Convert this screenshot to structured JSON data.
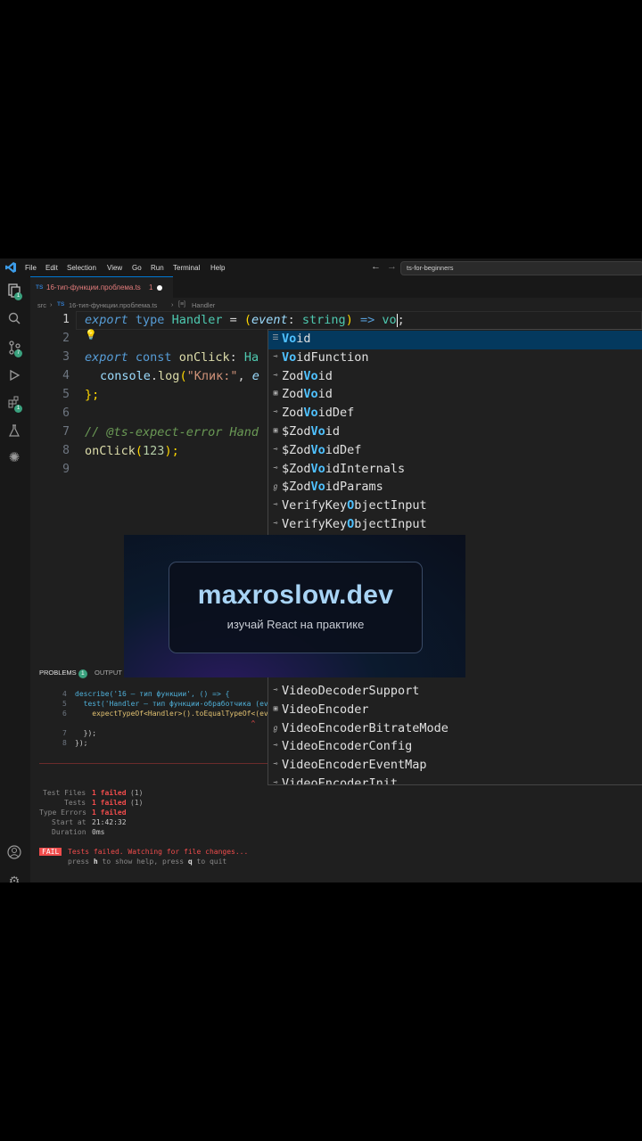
{
  "titlebar": {
    "menu": [
      "File",
      "Edit",
      "Selection",
      "View",
      "Go",
      "Run",
      "Terminal",
      "Help"
    ],
    "search": "ts-for-beginners"
  },
  "tab": {
    "badge": "TS",
    "name": "16-тип-функции.проблема.ts",
    "count": "1"
  },
  "breadcrumb": {
    "folder": "src",
    "badge": "TS",
    "file": "16-тип-функции.проблема.ts",
    "symbol": "Handler"
  },
  "activity_badges": [
    "1",
    "7",
    "1"
  ],
  "editor": {
    "line_numbers": [
      "1",
      "2",
      "3",
      "4",
      "5",
      "6",
      "7",
      "8",
      "9"
    ],
    "line1": {
      "export": "export",
      "type": "type",
      "name": "Handler",
      "eq": " = ",
      "open": "(",
      "param": "event",
      "colon": ": ",
      "ptype": "string",
      "close": ")",
      "arrow": " => ",
      "typed": "vo",
      "semi": ";"
    },
    "line3": {
      "export": "export",
      "const": "const",
      "name": "onClick",
      "colon": ":",
      "partial": "Ha"
    },
    "line4": {
      "obj": "console",
      "dot": ".",
      "method": "log",
      "open": "(",
      "str": "\"Клик:\"",
      "comma": ", ",
      "partial": "e"
    },
    "line5": {
      "text": "};"
    },
    "line7": {
      "comment": "// @ts-expect-error Hand"
    },
    "line8": {
      "fn": "onClick",
      "open": "(",
      "num": "123",
      "close": ");"
    }
  },
  "suggestions": [
    {
      "icon": "keyword-icon",
      "pre": "",
      "match": "Vo",
      "post": "id",
      "label": "void"
    },
    {
      "icon": "interface-icon",
      "pre": "",
      "match": "Vo",
      "post": "idFunction",
      "label": "VoidFunction"
    },
    {
      "icon": "interface-icon",
      "pre": "Zod",
      "match": "Vo",
      "post": "id",
      "label": "ZodVoid"
    },
    {
      "icon": "class-icon",
      "pre": "Zod",
      "match": "Vo",
      "post": "id",
      "label": "ZodVoid"
    },
    {
      "icon": "interface-icon",
      "pre": "Zod",
      "match": "Vo",
      "post": "idDef",
      "label": "ZodVoidDef"
    },
    {
      "icon": "class-icon",
      "pre": "$Zod",
      "match": "Vo",
      "post": "id",
      "label": "$ZodVoid"
    },
    {
      "icon": "interface-icon",
      "pre": "$Zod",
      "match": "Vo",
      "post": "idDef",
      "label": "$ZodVoidDef"
    },
    {
      "icon": "interface-icon",
      "pre": "$Zod",
      "match": "Vo",
      "post": "idInternals",
      "label": "$ZodVoidInternals"
    },
    {
      "icon": "type-icon",
      "pre": "$Zod",
      "match": "Vo",
      "post": "idParams",
      "label": "$ZodVoidParams"
    },
    {
      "icon": "interface-icon",
      "pre": "VerifyKey",
      "match": "O",
      "post": "bjectInput",
      "label": "VerifyKeyObjectInput"
    },
    {
      "icon": "interface-icon",
      "pre": "VerifyKey",
      "match": "O",
      "post": "bjectInput",
      "label": "VerifyKeyObjectInput"
    },
    {
      "icon": "interface-icon",
      "pre": "Video",
      "match": "",
      "post": "DecoderSupport",
      "label": "VideoDecoderSupport"
    },
    {
      "icon": "class-icon",
      "pre": "Video",
      "match": "",
      "post": "Encoder",
      "label": "VideoEncoder"
    },
    {
      "icon": "type-icon",
      "pre": "Video",
      "match": "",
      "post": "EncoderBitrateMode",
      "label": "VideoEncoderBitrateMode"
    },
    {
      "icon": "interface-icon",
      "pre": "Video",
      "match": "",
      "post": "EncoderConfig",
      "label": "VideoEncoderConfig"
    },
    {
      "icon": "interface-icon",
      "pre": "Video",
      "match": "",
      "post": "EncoderEventMap",
      "label": "VideoEncoderEventMap"
    },
    {
      "icon": "interface-icon",
      "pre": "",
      "match": "",
      "post": "VideoEncoderInit",
      "label": "VideoEncoderInit"
    }
  ],
  "promo": {
    "domain": "maxroslow.dev",
    "tagline": "изучай React на практике"
  },
  "panel": {
    "tabs": [
      {
        "label": "PROBLEMS",
        "badge": "1"
      },
      {
        "label": "OUTPUT"
      }
    ],
    "code_lines": [
      {
        "num": "4",
        "text": "describe('16 – тип функции', () => {"
      },
      {
        "num": "5",
        "text": "  test('Handler – тип функции-обработчика (even"
      },
      {
        "num": "6",
        "text": "    expectTypeOf<Handler>().toEqualTypeOf<(even"
      },
      {
        "num": "",
        "text": "                                         ^"
      },
      {
        "num": "7",
        "text": "  });"
      },
      {
        "num": "8",
        "text": "});"
      }
    ],
    "summary": [
      {
        "label": "Test Files",
        "value": "1 failed",
        "extra": "(1)"
      },
      {
        "label": "Tests",
        "value": "1 failed",
        "extra": "(1)"
      },
      {
        "label": "Type Errors",
        "value": "1 failed",
        "extra": ""
      },
      {
        "label": "Start at",
        "value": "21:42:32",
        "extra": ""
      },
      {
        "label": "Duration",
        "value": "0ms",
        "extra": ""
      }
    ],
    "fail_badge": "FAIL",
    "fail_msg": "Tests failed. Watching for file changes...",
    "help_press1": "press ",
    "help_h": "h",
    "help_mid": " to show help, press ",
    "help_q": "q",
    "help_end": " to quit"
  },
  "colors": {
    "accent": "#0078d4",
    "fail": "#f14c4c",
    "match": "#4fc1ff"
  }
}
